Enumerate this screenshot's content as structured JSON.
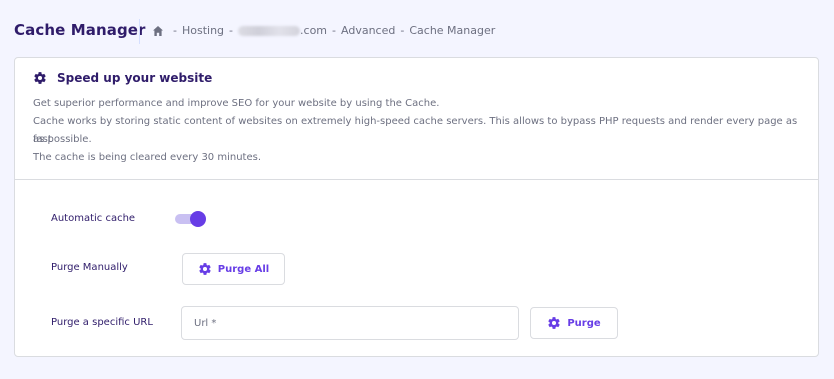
{
  "header": {
    "page_title": "Cache Manager",
    "breadcrumb": [
      "Hosting",
      ".com",
      "Advanced",
      "Cache Manager"
    ],
    "breadcrumb_separator": "-"
  },
  "card": {
    "title": "Speed up your website",
    "description": [
      "Get superior performance and improve SEO for your website by using the Cache.",
      "Cache works by storing static content of websites on extremely high-speed cache servers. This allows to bypass PHP requests and render every page as fast",
      "as possible.",
      "The cache is being cleared every 30 minutes."
    ],
    "automatic_cache": {
      "label": "Automatic cache",
      "enabled": true
    },
    "purge_manually": {
      "label": "Purge Manually",
      "button": "Purge All"
    },
    "purge_url": {
      "label": "Purge a specific URL",
      "placeholder": "Url *",
      "value": "",
      "button": "Purge"
    }
  },
  "icons": [
    "home-icon",
    "gear-icon"
  ],
  "colors": {
    "accent": "#673de6",
    "toggle_track": "#c9c0f2",
    "text_primary": "#2f1c6a",
    "text_secondary": "#6d7081",
    "background": "#f4f5ff"
  }
}
